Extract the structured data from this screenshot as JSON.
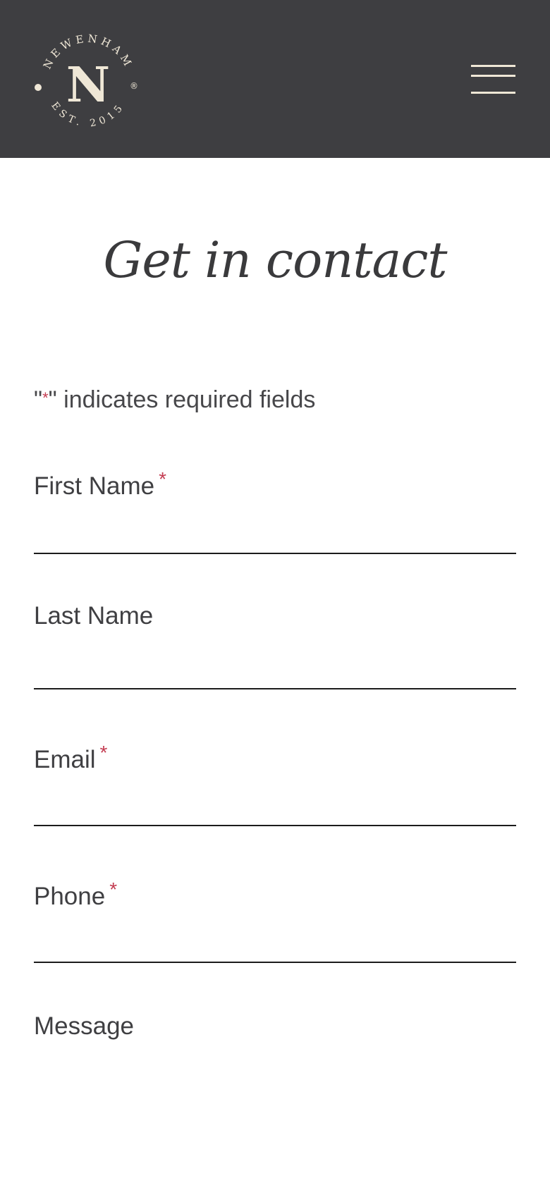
{
  "header": {
    "logo": {
      "brand": "NEWENHAM",
      "monogram": "N",
      "established": "EST. 2015",
      "registered_mark": "®"
    },
    "menu_icon": "hamburger-menu-icon"
  },
  "page": {
    "title": "Get in contact",
    "required_note": {
      "prefix": "\"",
      "star": "*",
      "suffix": "\" indicates required fields"
    }
  },
  "form": {
    "fields": [
      {
        "label": "First Name",
        "required": true,
        "value": ""
      },
      {
        "label": "Last Name",
        "required": false,
        "value": ""
      },
      {
        "label": "Email",
        "required": true,
        "value": ""
      },
      {
        "label": "Phone",
        "required": true,
        "value": ""
      },
      {
        "label": "Message",
        "required": false,
        "value": ""
      }
    ],
    "required_marker": "*"
  },
  "colors": {
    "header_bg": "#3e3e41",
    "logo_cream": "#efe7d6",
    "required_red": "#c43d52",
    "text_dark": "#3c3c3f"
  }
}
